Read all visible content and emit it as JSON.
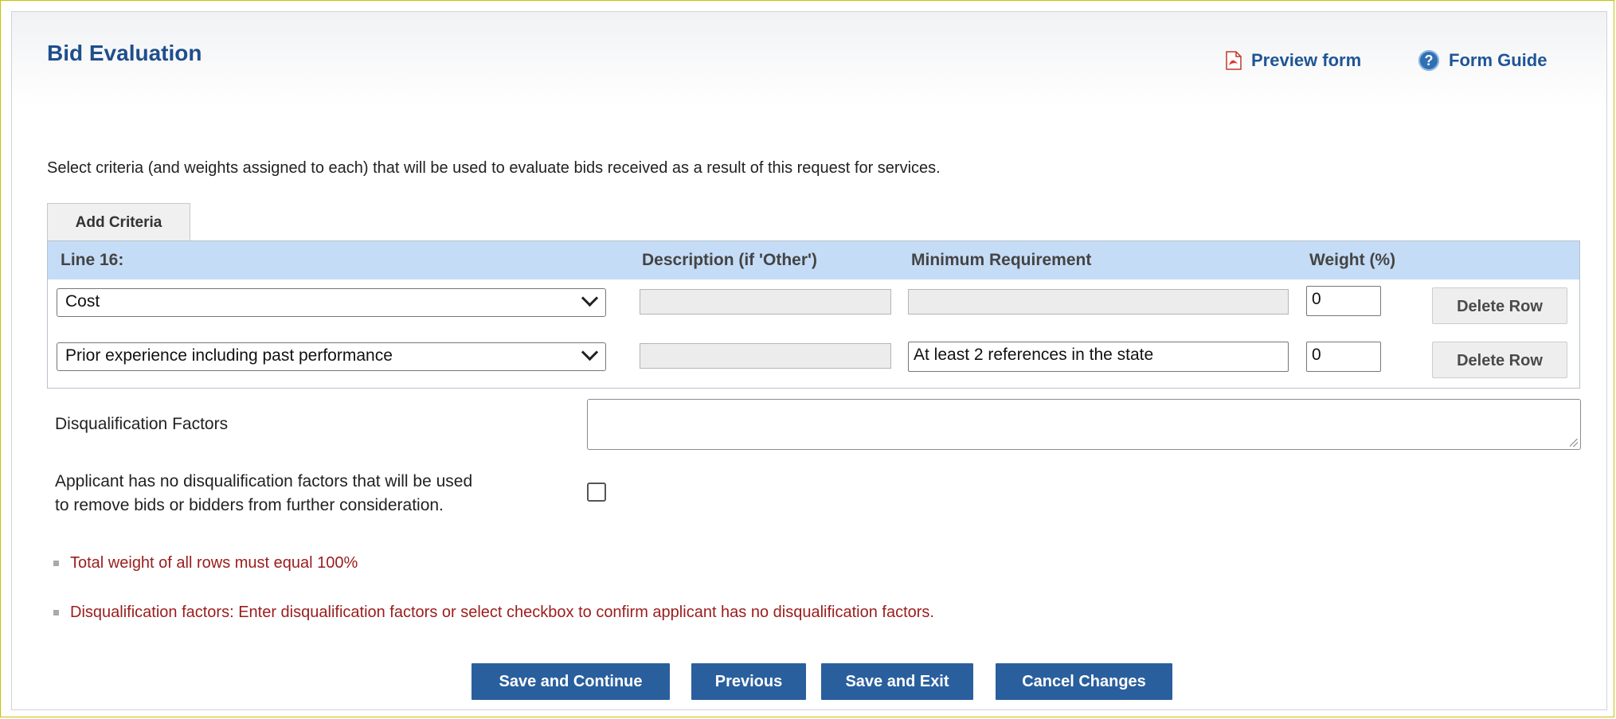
{
  "header": {
    "title": "Bid Evaluation",
    "preview_label": "Preview form",
    "guide_label": "Form Guide",
    "help_glyph": "?"
  },
  "instructions": "Select criteria (and weights assigned to each) that will be used to evaluate bids received as a result of this request for services.",
  "add_criteria_label": "Add Criteria",
  "grid": {
    "columns": [
      "Line 16:",
      "Description (if 'Other')",
      "Minimum Requirement",
      "Weight (%)"
    ],
    "rows": [
      {
        "criteria": "Cost",
        "description": "",
        "minimum_requirement": "",
        "weight": "0",
        "delete_label": "Delete Row"
      },
      {
        "criteria": "Prior experience including past performance",
        "description": "",
        "minimum_requirement": "At least 2 references in the state",
        "weight": "0",
        "delete_label": "Delete Row"
      }
    ]
  },
  "disqualification": {
    "label": "Disqualification Factors",
    "value": "",
    "checkbox_label_line1": "Applicant has no disqualification factors that will be used",
    "checkbox_label_line2": "to remove bids or bidders from further consideration.",
    "checked": false
  },
  "errors": [
    "Total weight of all rows must equal 100%",
    "Disqualification factors: Enter disqualification factors or select checkbox to confirm applicant has no disqualification factors."
  ],
  "buttons": {
    "save_continue": "Save and Continue",
    "previous": "Previous",
    "save_exit": "Save and Exit",
    "cancel": "Cancel Changes"
  },
  "colors": {
    "title": "#1f4e8c",
    "grid_header": "#c5dcf6",
    "error_text": "#9b1c1c",
    "primary_button": "#2a5f9e",
    "frame_border": "#c8c400"
  },
  "icons": {
    "preview": "pdf-icon",
    "guide": "help-icon",
    "dropdown": "chevron-down-icon"
  }
}
